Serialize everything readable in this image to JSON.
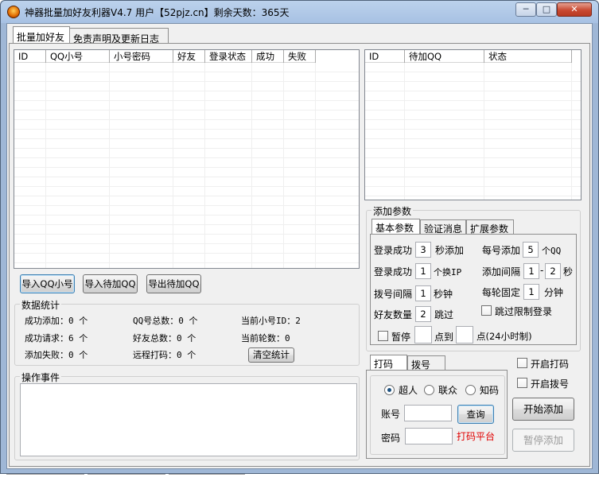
{
  "window": {
    "title": "神器批量加好友利器V4.7    用户【52pjz.cn】剩余天数：365天",
    "min_glyph": "─",
    "max_glyph": "□",
    "close_glyph": "✕"
  },
  "tabs": [
    {
      "label": "批量加好友"
    },
    {
      "label": "免责声明及更新日志"
    }
  ],
  "accounts_table": {
    "columns": [
      "ID",
      "QQ小号",
      "小号密码",
      "好友",
      "登录状态",
      "成功",
      "失败"
    ]
  },
  "pending_table": {
    "columns": [
      "ID",
      "待加QQ",
      "状态"
    ]
  },
  "buttons": {
    "import_qq": "导入QQ小号",
    "import_pending": "导入待加QQ",
    "export_pending": "导出待加QQ",
    "clear_stats": "清空统计",
    "start": "开始添加",
    "pause": "暂停添加",
    "query": "查询"
  },
  "stats": {
    "group_label": "数据统计",
    "success_add": "成功添加：0 个",
    "success_request": "成功请求：6 个",
    "add_fail": "添加失败：0 个",
    "qq_total": "QQ号总数：0 个",
    "friend_total": "好友总数：0 个",
    "remote_captcha": "远程打码：0 个",
    "current_id": "当前小号ID：2",
    "current_round": "当前轮数：0"
  },
  "events": {
    "group_label": "操作事件"
  },
  "params": {
    "group_label": "添加参数",
    "tabs": [
      "基本参数",
      "验证消息",
      "扩展参数"
    ],
    "login_success_1": "登录成功",
    "login_success_1_value": "3",
    "seconds_add": "秒添加",
    "login_success_2": "登录成功",
    "login_success_2_value": "1",
    "change_ip": "个换IP",
    "dial_interval": "拨号间隔",
    "dial_interval_value": "1",
    "seconds": "秒钟",
    "friend_count": "好友数量",
    "friend_count_value": "2",
    "skip": "跳过",
    "per_account": "每号添加",
    "per_account_value": "5",
    "per_qq": "个QQ",
    "add_interval": "添加间隔",
    "add_interval_from": "1",
    "add_interval_dash": "-",
    "add_interval_to": "2",
    "sec_unit": "秒",
    "per_round": "每轮固定",
    "per_round_value": "1",
    "minutes": "分钟",
    "skip_limited": "跳过限制登录",
    "pause": "暂停",
    "to": "点到",
    "hour_note": "点(24小时制)"
  },
  "captcha": {
    "tabs": [
      "打码",
      "拨号"
    ],
    "options": [
      "超人",
      "联众",
      "知码"
    ],
    "selected": "超人",
    "account_label": "账号",
    "password_label": "密码",
    "platform": "打码平台",
    "enable_captcha": "开启打码",
    "enable_dial": "开启拨号"
  },
  "colors": {
    "platform_red": "#e00000"
  }
}
